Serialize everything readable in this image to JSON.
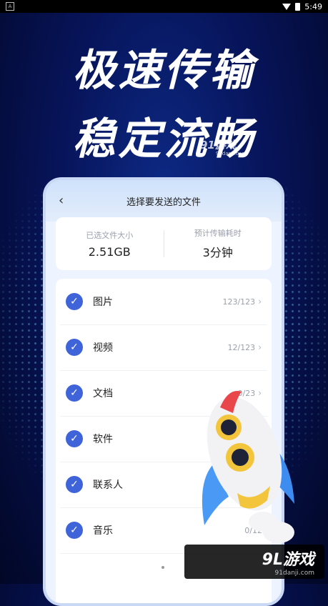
{
  "status_bar": {
    "time": "5:49"
  },
  "headline": {
    "line1": "极速传输",
    "line2": "稳定流畅"
  },
  "watermark_top": {
    "brand": "91游戏",
    "site": "91danji.com"
  },
  "screen": {
    "title": "选择要发送的文件",
    "summary": {
      "size_label": "已选文件大小",
      "size_value": "2.51GB",
      "time_label": "预计传输耗时",
      "time_value": "3分钟"
    },
    "items": [
      {
        "label": "图片",
        "count": "123/123"
      },
      {
        "label": "视频",
        "count": "12/123"
      },
      {
        "label": "文档",
        "count": "0/23"
      },
      {
        "label": "软件",
        "count": ""
      },
      {
        "label": "联系人",
        "count": ""
      },
      {
        "label": "音乐",
        "count": "0/123"
      }
    ]
  },
  "watermark_bottom": {
    "brand": "9L游戏",
    "site": "91danji.com"
  },
  "colors": {
    "accent": "#3f63d8",
    "background": "#07145a"
  }
}
